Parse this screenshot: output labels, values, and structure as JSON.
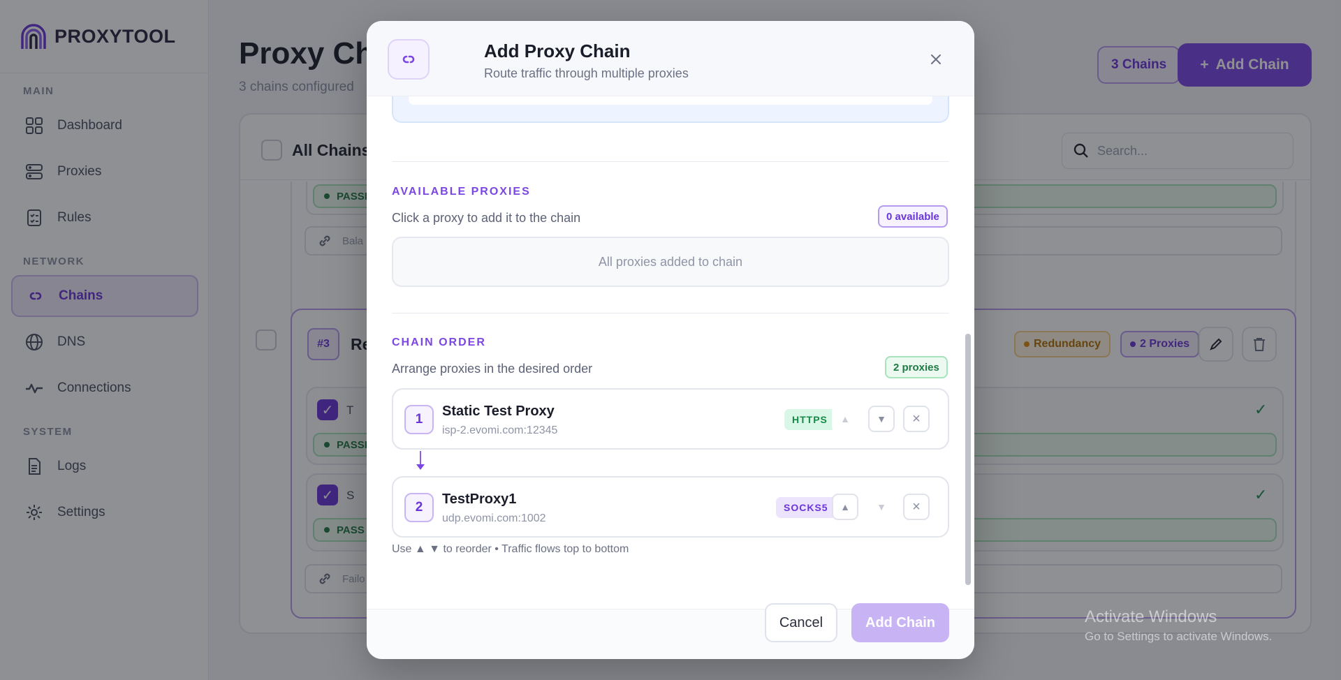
{
  "app": {
    "logo_text": "PROXYTOOL"
  },
  "sidebar": {
    "sections": {
      "main": "MAIN",
      "network": "NETWORK",
      "system": "SYSTEM"
    },
    "items": [
      {
        "label": "Dashboard",
        "icon": "grid-icon"
      },
      {
        "label": "Proxies",
        "icon": "server-icon"
      },
      {
        "label": "Rules",
        "icon": "checklist-icon"
      },
      {
        "label": "Chains",
        "icon": "link-icon",
        "active": true
      },
      {
        "label": "DNS",
        "icon": "globe-icon"
      },
      {
        "label": "Connections",
        "icon": "activity-icon"
      },
      {
        "label": "Logs",
        "icon": "document-icon"
      },
      {
        "label": "Settings",
        "icon": "gear-icon"
      }
    ]
  },
  "header": {
    "title": "Proxy Cha",
    "subtitle": "3 chains configured",
    "chains_chip": "3 Chains",
    "add_chain_label": "Add Chain",
    "add_chain_plus": "+"
  },
  "panel": {
    "all_chains": "All Chains",
    "search_placeholder": "Search...",
    "pass_label": "PASSI",
    "pass_label_short": "PASS",
    "balance_text": "Bala",
    "failover_text": "Failo",
    "chain3": {
      "num": "#3",
      "name": "Re",
      "tag_redundancy": "Redundancy",
      "tag_proxies": "2 Proxies",
      "row1_text": "T",
      "row2_text": "S",
      "check": "✓"
    }
  },
  "modal": {
    "title": "Add Proxy Chain",
    "subtitle": "Route traffic through multiple proxies",
    "close_glyph": "×",
    "available": {
      "label": "AVAILABLE PROXIES",
      "desc": "Click a proxy to add it to the chain",
      "badge": "0 available",
      "empty": "All proxies added to chain"
    },
    "order": {
      "label": "CHAIN ORDER",
      "desc": "Arrange proxies in the desired order",
      "badge": "2 proxies",
      "items": [
        {
          "num": "1",
          "name": "Static Test Proxy",
          "host": "isp-2.evomi.com:12345",
          "protocol": "HTTPS"
        },
        {
          "num": "2",
          "name": "TestProxy1",
          "host": "udp.evomi.com:1002",
          "protocol": "SOCKS5"
        }
      ],
      "hint": "Use ▲ ▼ to reorder • Traffic flows top to bottom",
      "up": "▲",
      "down": "▼",
      "remove": "×"
    },
    "cancel_label": "Cancel",
    "submit_label": "Add Chain"
  },
  "watermark": {
    "line1": "Activate Windows",
    "line2": "Go to Settings to activate Windows."
  },
  "colors": {
    "accent": "#7c45e6",
    "https_bg": "#d9f7e6",
    "https_fg": "#178a4a",
    "socks_bg": "#ece3fd",
    "socks_fg": "#6a35d9",
    "warn": "#d98a0b"
  }
}
